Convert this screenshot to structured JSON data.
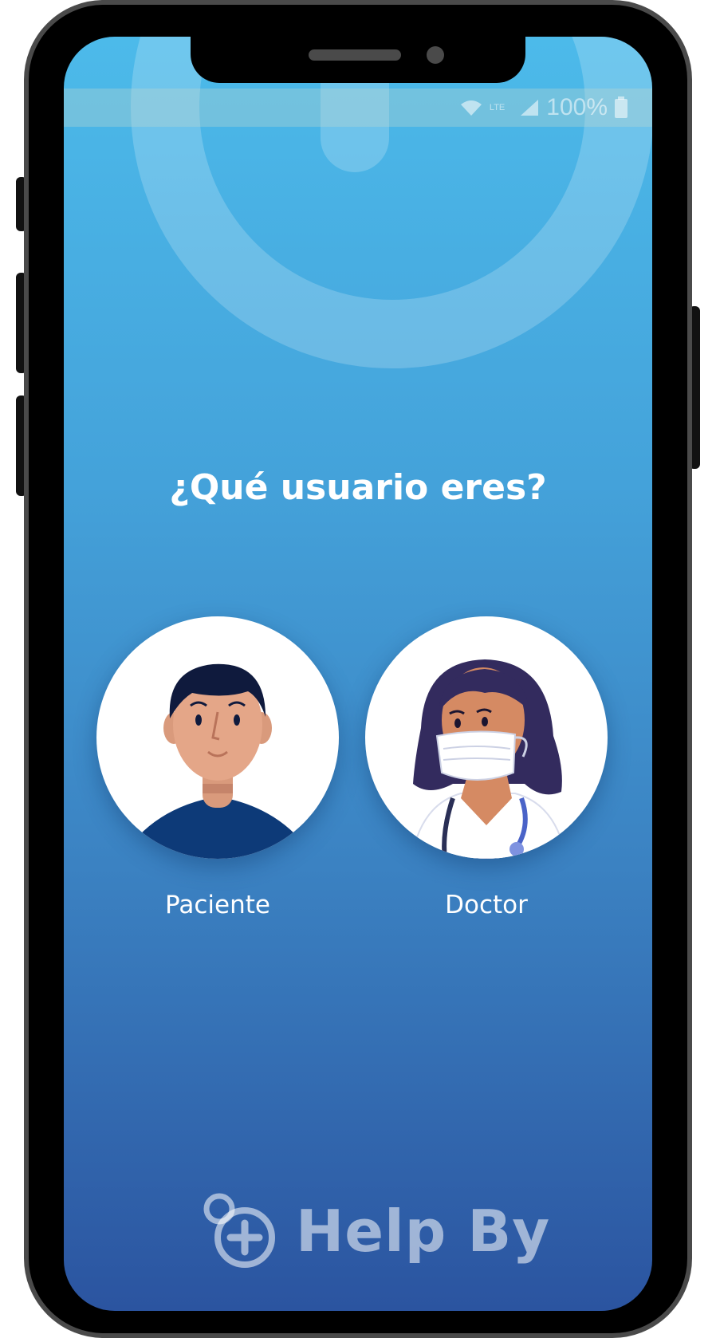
{
  "statusbar": {
    "network": "LTE",
    "battery": "100%"
  },
  "prompt": {
    "question": "¿Qué usuario eres?"
  },
  "options": [
    {
      "label": "Paciente",
      "icon": "patient-avatar-icon"
    },
    {
      "label": "Doctor",
      "icon": "doctor-avatar-icon"
    }
  ],
  "brand": {
    "name": "Help By",
    "icon": "helpby-logo-icon"
  },
  "colors": {
    "gradient_top": "#4cbaea",
    "gradient_bottom": "#2b54a0",
    "phone_frame": "#000000",
    "bezel": "#4a4a4a"
  }
}
